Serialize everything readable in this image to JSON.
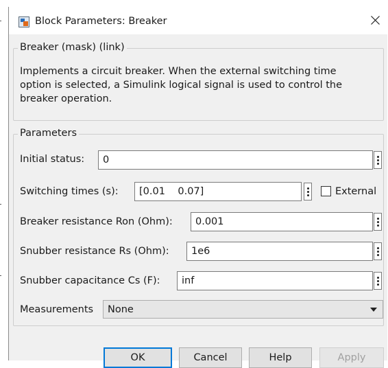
{
  "window": {
    "title": "Block Parameters: Breaker",
    "icon": "simulink-block-icon",
    "close_icon": "close-icon"
  },
  "mask": {
    "title": "Breaker (mask) (link)",
    "description": "Implements a circuit breaker. When the external switching time\noption is selected, a Simulink logical signal is used to control the\nbreaker operation."
  },
  "parameters": {
    "title": "Parameters",
    "initial_status": {
      "label": "Initial status:",
      "value": "0"
    },
    "switching_times": {
      "label": "Switching times (s):",
      "value": "[0.01    0.07]",
      "external_label": "External",
      "external_checked": false
    },
    "ron": {
      "label": "Breaker resistance Ron (Ohm):",
      "value": "0.001"
    },
    "rs": {
      "label": "Snubber resistance Rs (Ohm):",
      "value": "1e6"
    },
    "cs": {
      "label": "Snubber capacitance Cs (F):",
      "value": "inf"
    },
    "measurements": {
      "label": "Measurements",
      "value": "None"
    }
  },
  "buttons": {
    "ok": "OK",
    "cancel": "Cancel",
    "help": "Help",
    "apply": "Apply"
  }
}
